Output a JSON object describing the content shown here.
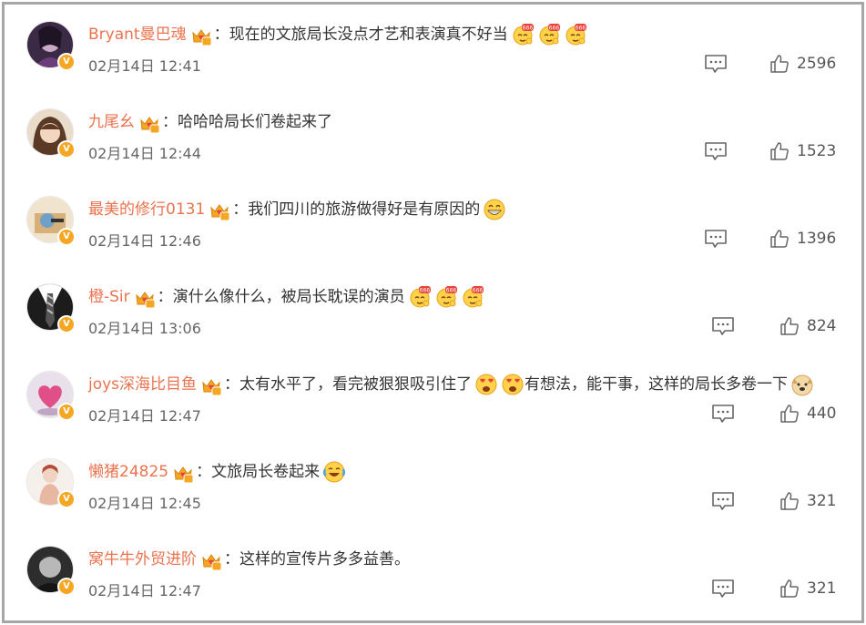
{
  "comments": [
    {
      "user": "Bryant曼巴魂",
      "text": "：现在的文旅局长没点才艺和表演真不好当",
      "emojis": [
        "666",
        "666",
        "666"
      ],
      "emojis_mid": [],
      "text2": "",
      "emojis_end": [],
      "time": "02月14日 12:41",
      "likes": "2596",
      "avatar": "purple-portrait"
    },
    {
      "user": "九尾幺",
      "text": "：哈哈哈局长们卷起来了",
      "emojis": [],
      "emojis_mid": [],
      "text2": "",
      "emojis_end": [],
      "time": "02月14日 12:44",
      "likes": "1523",
      "avatar": "girl-illustration"
    },
    {
      "user": "最美的修行0131",
      "text": "：我们四川的旅游做得好是有原因的",
      "emojis": [
        "grin"
      ],
      "emojis_mid": [],
      "text2": "",
      "emojis_end": [],
      "time": "02月14日 12:46",
      "likes": "1396",
      "avatar": "cartoon-box"
    },
    {
      "user": "橙-Sir",
      "text": "：演什么像什么，被局长耽误的演员",
      "emojis": [
        "666",
        "666",
        "666"
      ],
      "emojis_mid": [],
      "text2": "",
      "emojis_end": [],
      "time": "02月14日 13:06",
      "likes": "824",
      "avatar": "suit-tie"
    },
    {
      "user": "joys深海比目鱼",
      "text": "：太有水平了，看完被狠狠吸引住了",
      "emojis": [
        "heart-eyes",
        "heart-eyes"
      ],
      "emojis_mid": [],
      "text2": "有想法，能干事，这样的局长多卷一下",
      "emojis_end": [
        "doge"
      ],
      "time": "02月14日 12:47",
      "likes": "440",
      "avatar": "pink-heart"
    },
    {
      "user": "懒猪24825",
      "text": "：文旅局长卷起来",
      "emojis": [
        "laugh-cry"
      ],
      "emojis_mid": [],
      "text2": "",
      "emojis_end": [],
      "time": "02月14日 12:45",
      "likes": "321",
      "avatar": "woman-illustration"
    },
    {
      "user": "窝牛牛外贸进阶",
      "text": "：这样的宣传片多多益善。",
      "emojis": [],
      "emojis_mid": [],
      "text2": "",
      "emojis_end": [],
      "time": "02月14日 12:47",
      "likes": "321",
      "avatar": "bw-man"
    }
  ],
  "badge": "V",
  "colors": {
    "username": "#eb7350",
    "badge": "#f5a623",
    "border": "#a6a6a6"
  },
  "icons": {
    "vip": "vip-crown-icon",
    "comment": "comment-icon",
    "like": "thumbs-up-icon"
  }
}
